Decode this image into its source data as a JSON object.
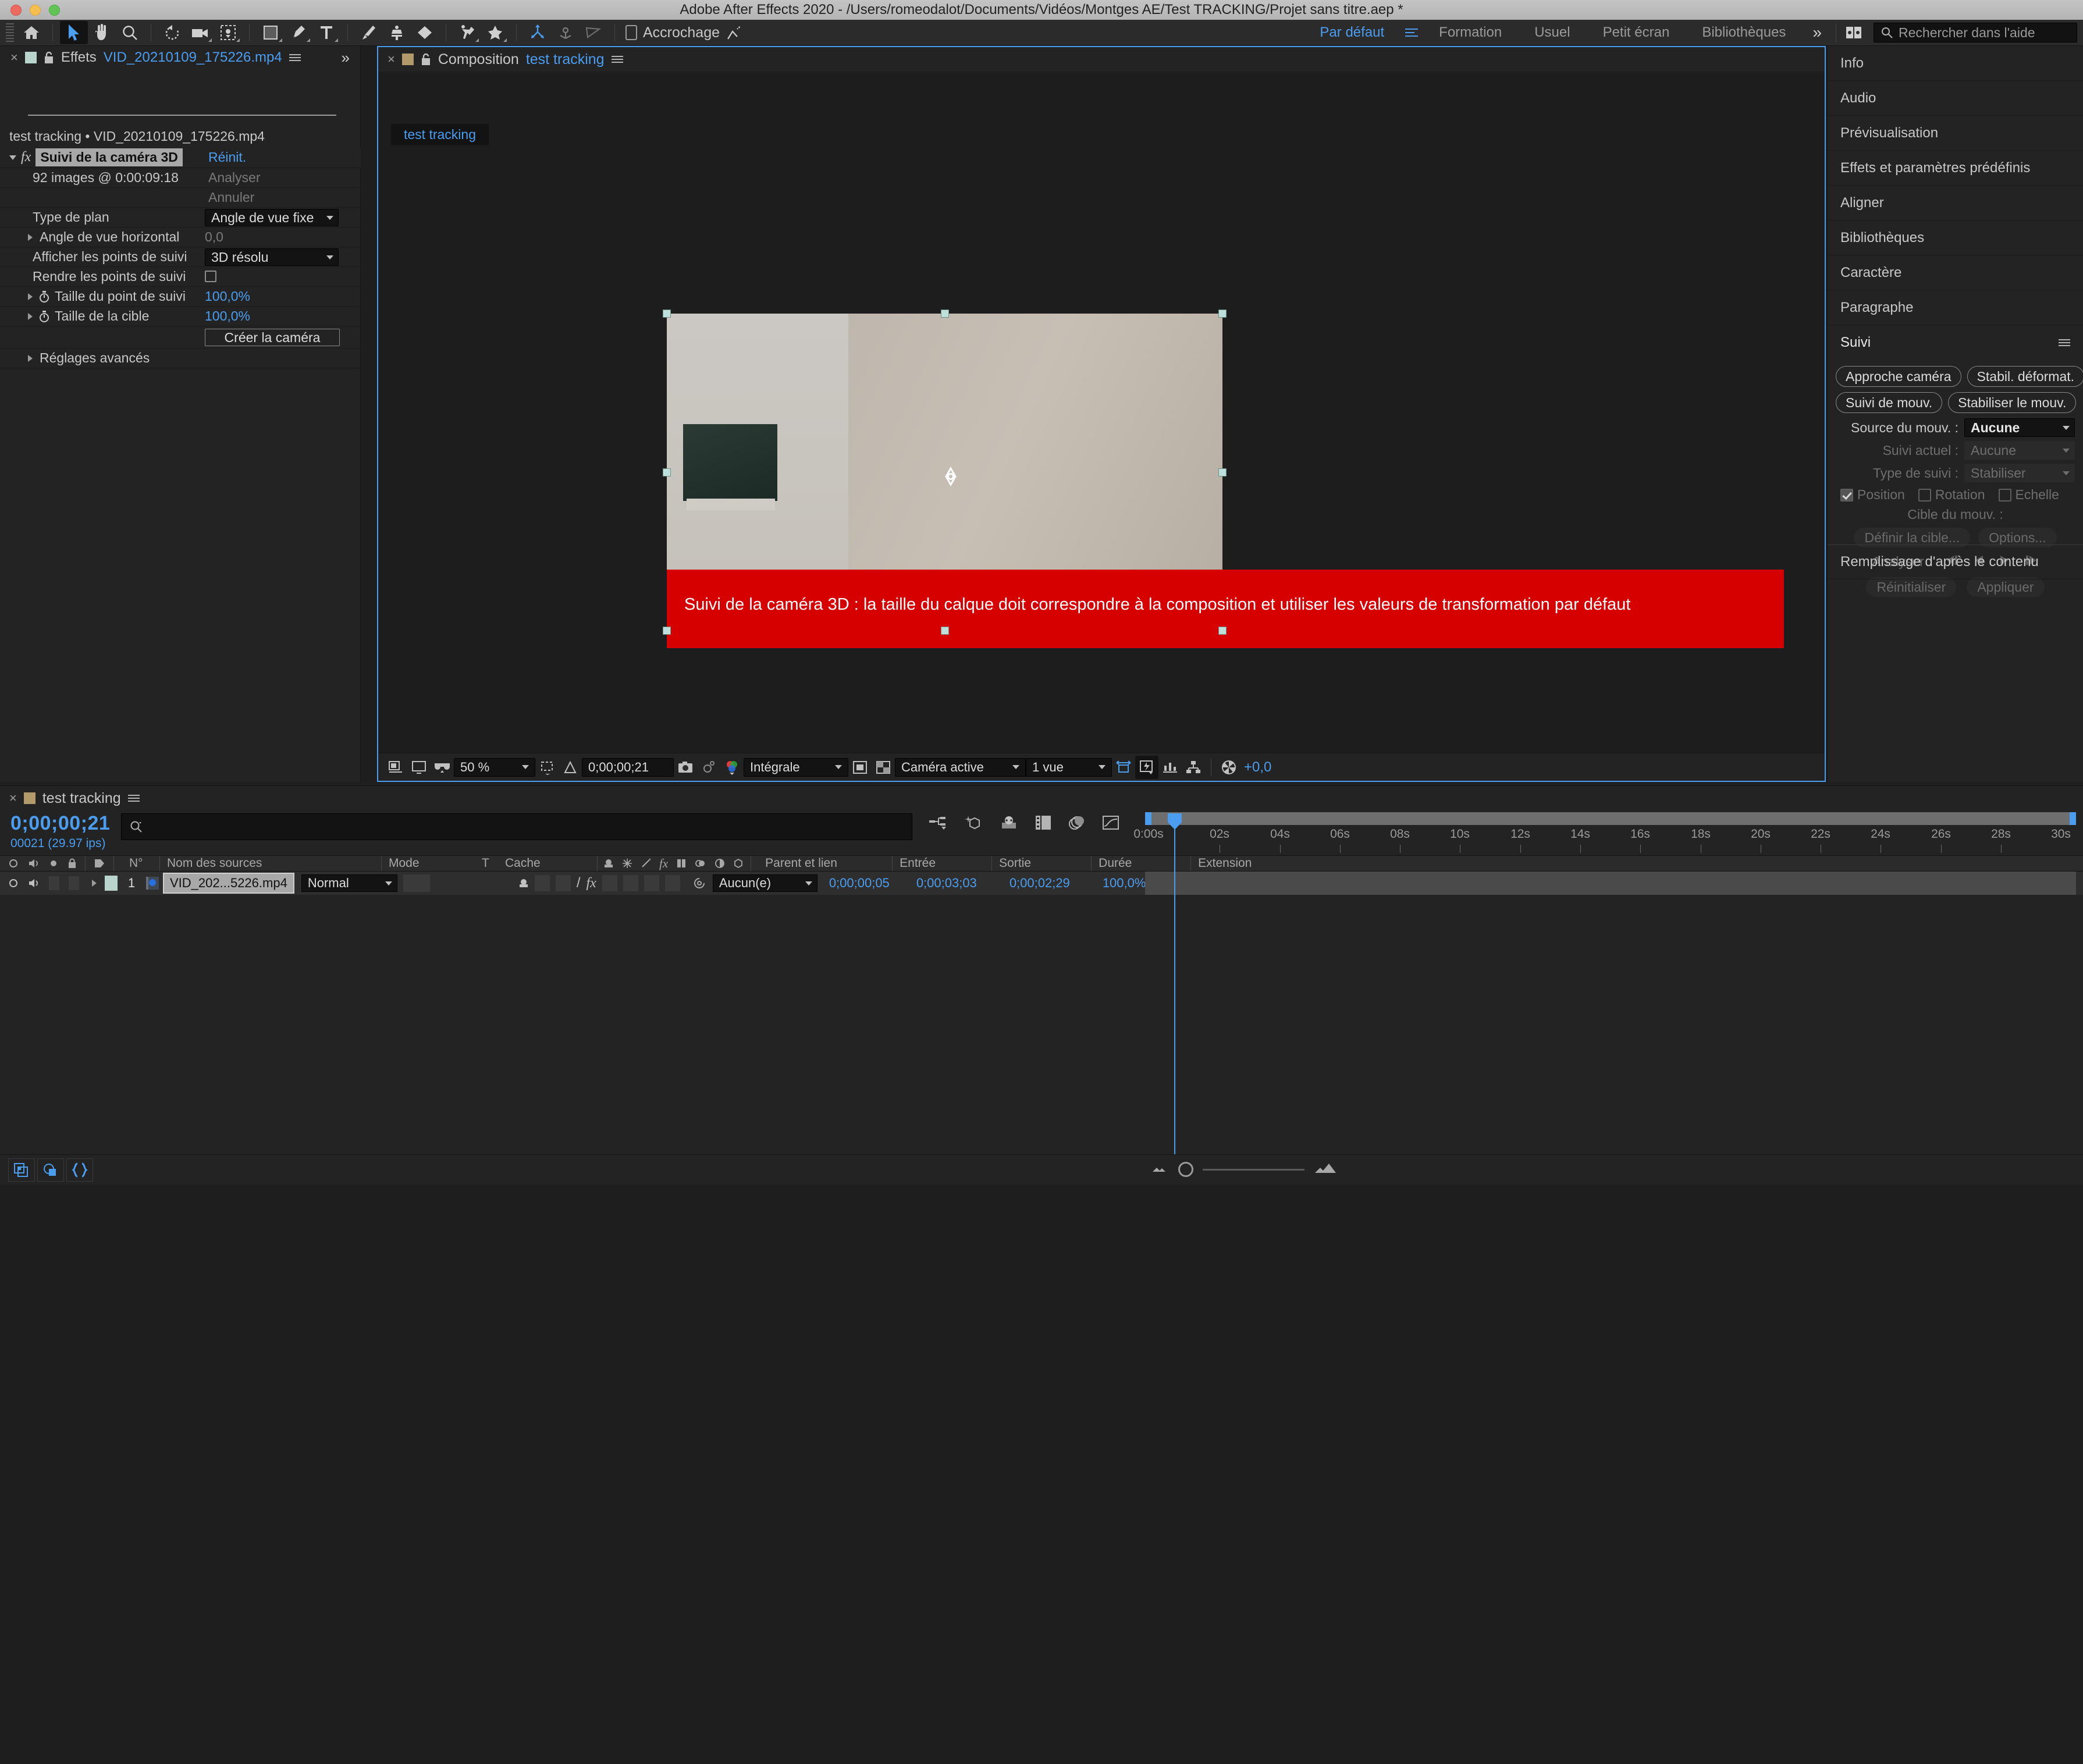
{
  "window": {
    "title": "Adobe After Effects 2020 - /Users/romeodalot/Documents/Vidéos/Montges AE/Test TRACKING/Projet sans titre.aep *"
  },
  "toolbar": {
    "snap_label": "Accrochage",
    "tools": [
      {
        "name": "home-icon",
        "label": "Accueil"
      },
      {
        "name": "selection-tool",
        "label": "Sélection"
      },
      {
        "name": "hand-tool",
        "label": "Main"
      },
      {
        "name": "zoom-tool",
        "label": "Zoom"
      },
      {
        "name": "rotation-tool",
        "label": "Rotation"
      },
      {
        "name": "camera-tool",
        "label": "Caméra"
      },
      {
        "name": "anchor-point-tool",
        "label": "Point d'ancrage"
      },
      {
        "name": "shape-tool",
        "label": "Forme"
      },
      {
        "name": "pen-tool",
        "label": "Plume"
      },
      {
        "name": "text-tool",
        "label": "Texte"
      },
      {
        "name": "brush-tool",
        "label": "Pinceau"
      },
      {
        "name": "clone-stamp-tool",
        "label": "Tampon"
      },
      {
        "name": "eraser-tool",
        "label": "Gomme"
      },
      {
        "name": "roto-brush-tool",
        "label": "Rotoscopie"
      },
      {
        "name": "puppet-tool",
        "label": "Marionnette"
      }
    ]
  },
  "workspaces": {
    "items": [
      {
        "label": "Par défaut",
        "active": true
      },
      {
        "label": "Formation",
        "active": false
      },
      {
        "label": "Usuel",
        "active": false
      },
      {
        "label": "Petit écran",
        "active": false
      },
      {
        "label": "Bibliothèques",
        "active": false
      }
    ],
    "overflow": "»",
    "help_placeholder": "Rechercher dans l'aide"
  },
  "effects_panel": {
    "close": "×",
    "tab_label": "Effets",
    "tab_file": "VID_20210109_175226.mp4",
    "subtitle": "test tracking • VID_20210109_175226.mp4",
    "effect_name": "Suivi de la caméra 3D",
    "reset_label": "Réinit.",
    "fx_badge": "fx",
    "status_text": "92 images @ 0:00:09:18",
    "analyse_label": "Analyser",
    "cancel_label": "Annuler",
    "rows": [
      {
        "label": "Type de plan",
        "value": "Angle de vue fixe",
        "kind": "dropdown",
        "dim": false
      },
      {
        "label": "Angle de vue horizontal",
        "value": "0,0",
        "kind": "number",
        "dim": true
      },
      {
        "label": "Afficher les points de suivi",
        "value": "3D résolu",
        "kind": "dropdown",
        "dim": false
      },
      {
        "label": "Rendre les points de suivi",
        "value": "",
        "kind": "checkbox",
        "dim": false
      },
      {
        "label": "Taille du point de suivi",
        "value": "100,0%",
        "kind": "value",
        "dim": false
      },
      {
        "label": "Taille de la cible",
        "value": "100,0%",
        "kind": "value",
        "dim": false
      }
    ],
    "create_camera_label": "Créer la caméra",
    "advanced_label": "Réglages avancés"
  },
  "composition_panel": {
    "close": "×",
    "tab_label": "Composition",
    "comp_name": "test tracking",
    "comp_tab_chip": "test tracking",
    "warning_text": "Suivi de la caméra 3D : la taille du calque doit correspondre à la composition et utiliser les valeurs de transformation par défaut",
    "warning_color": "#d70000",
    "bottom_bar": {
      "magnification": "50 %",
      "current_time": "0;00;00;21",
      "resolution": "Intégrale",
      "view": "Caméra active",
      "views_count": "1 vue",
      "exposure": "+0,0"
    }
  },
  "right_panels": [
    {
      "label": "Info",
      "expanded": false
    },
    {
      "label": "Audio",
      "expanded": false
    },
    {
      "label": "Prévisualisation",
      "expanded": false
    },
    {
      "label": "Effets et paramètres prédéfinis",
      "expanded": false
    },
    {
      "label": "Aligner",
      "expanded": false
    },
    {
      "label": "Bibliothèques",
      "expanded": false
    },
    {
      "label": "Caractère",
      "expanded": false
    },
    {
      "label": "Paragraphe",
      "expanded": false
    }
  ],
  "tracker_panel": {
    "title": "Suivi",
    "buttons": [
      "Approche caméra",
      "Stabil. déformat.",
      "Suivi de mouv.",
      "Stabiliser le mouv."
    ],
    "motion_source_label": "Source du mouv. :",
    "motion_source_value": "Aucune",
    "current_track_label": "Suivi actuel :",
    "current_track_value": "Aucune",
    "track_type_label": "Type de suivi :",
    "track_type_value": "Stabiliser",
    "checkboxes": [
      {
        "label": "Position",
        "checked": true
      },
      {
        "label": "Rotation",
        "checked": false
      },
      {
        "label": "Echelle",
        "checked": false
      }
    ],
    "motion_target_label": "Cible du mouv. :",
    "set_target_label": "Définir la cible...",
    "options_label": "Options...",
    "analyse_label": "Analyser :",
    "reset_label": "Réinitialiser",
    "apply_label": "Appliquer"
  },
  "content_aware_fill": {
    "label": "Remplissage d'après le contenu"
  },
  "timeline": {
    "close": "×",
    "comp_name": "test tracking",
    "current_timecode": "0;00;00;21",
    "frame_info": "00021 (29.97 ips)",
    "search_placeholder": "",
    "columns": [
      "N°",
      "Nom des sources",
      "Mode",
      "T",
      "Cache",
      "Parent et lien",
      "Entrée",
      "Sortie",
      "Durée",
      "Extension"
    ],
    "layers": [
      {
        "index": "1",
        "source_name": "VID_202...5226.mp4",
        "mode": "Normal",
        "track_matte": "",
        "parent": "Aucun(e)",
        "in": "0;00;00;05",
        "out": "0;00;03;03",
        "duration": "0;00;02;29",
        "stretch": "100,0%"
      }
    ],
    "ruler_ticks": [
      "0:00s",
      "02s",
      "04s",
      "06s",
      "08s",
      "10s",
      "12s",
      "14s",
      "16s",
      "18s",
      "20s",
      "22s",
      "24s",
      "26s",
      "28s",
      "30s"
    ]
  }
}
